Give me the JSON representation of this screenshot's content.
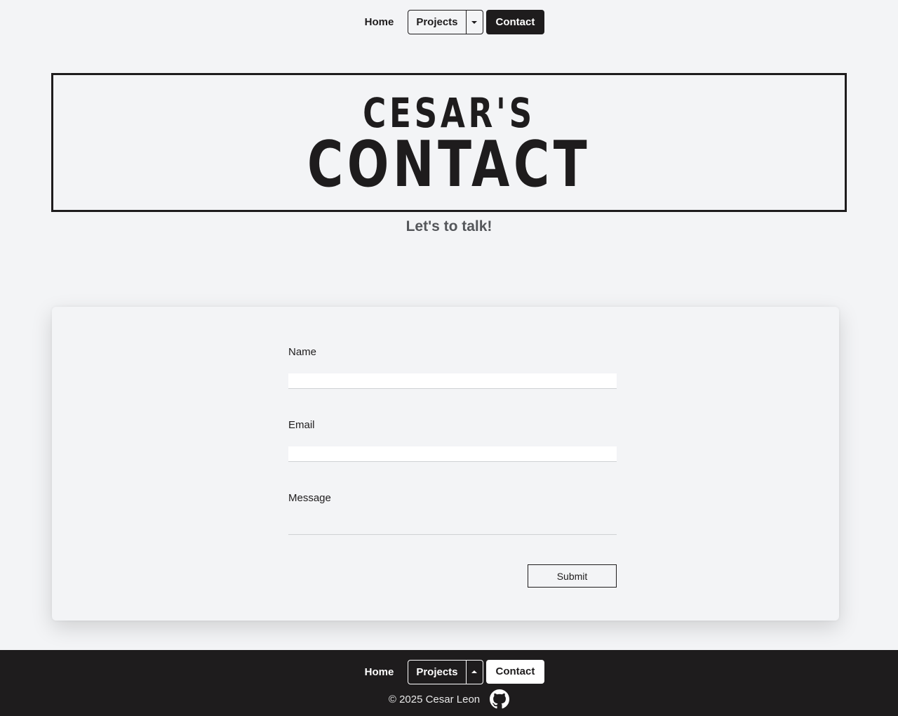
{
  "nav": {
    "home": "Home",
    "projects": "Projects",
    "contact": "Contact"
  },
  "hero": {
    "line1": "CESAR'S",
    "line2": "CONTACT",
    "subtitle": "Let's to talk!"
  },
  "form": {
    "name_label": "Name",
    "name_value": "",
    "email_label": "Email",
    "email_value": "",
    "message_label": "Message",
    "message_value": "",
    "submit_label": "Submit"
  },
  "footer": {
    "home": "Home",
    "projects": "Projects",
    "contact": "Contact",
    "copyright": "© 2025 Cesar Leon",
    "github_icon": "github-icon"
  },
  "colors": {
    "background": "#f3f4f6",
    "dark": "#1e1c1d",
    "subtitle": "#54565a"
  }
}
